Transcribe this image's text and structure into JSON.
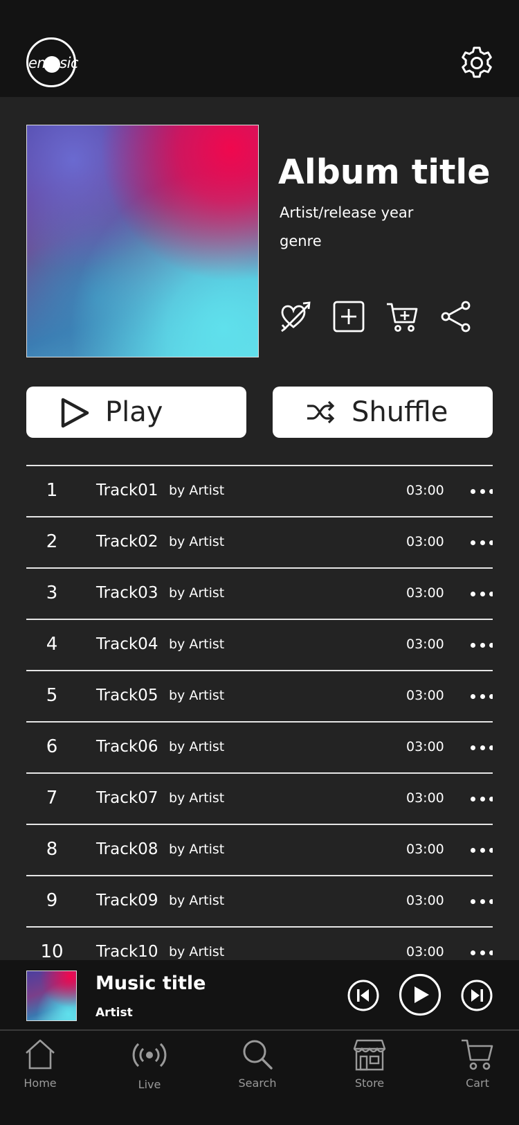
{
  "header": {
    "logo_text": "emusic",
    "icons": {
      "logo": "vinyl-logo",
      "settings": "gear-icon"
    }
  },
  "album": {
    "title": "Album title",
    "artist_year": "Artist/release year",
    "genre": "genre",
    "actions": [
      "heart-arrow-icon",
      "add-square-icon",
      "add-to-cart-icon",
      "share-icon"
    ]
  },
  "buttons": {
    "play": "Play",
    "shuffle": "Shuffle"
  },
  "tracks": [
    {
      "num": "1",
      "title": "Track01",
      "artist": "by Artist",
      "duration": "03:00"
    },
    {
      "num": "2",
      "title": "Track02",
      "artist": "by Artist",
      "duration": "03:00"
    },
    {
      "num": "3",
      "title": "Track03",
      "artist": "by Artist",
      "duration": "03:00"
    },
    {
      "num": "4",
      "title": "Track04",
      "artist": "by Artist",
      "duration": "03:00"
    },
    {
      "num": "5",
      "title": "Track05",
      "artist": "by Artist",
      "duration": "03:00"
    },
    {
      "num": "6",
      "title": "Track06",
      "artist": "by Artist",
      "duration": "03:00"
    },
    {
      "num": "7",
      "title": "Track07",
      "artist": "by Artist",
      "duration": "03:00"
    },
    {
      "num": "8",
      "title": "Track08",
      "artist": "by Artist",
      "duration": "03:00"
    },
    {
      "num": "9",
      "title": "Track09",
      "artist": "by Artist",
      "duration": "03:00"
    },
    {
      "num": "10",
      "title": "Track10",
      "artist": "by Artist",
      "duration": "03:00"
    }
  ],
  "player": {
    "title": "Music title",
    "artist": "Artist",
    "controls": [
      "previous-icon",
      "play-icon",
      "next-icon"
    ]
  },
  "tabs": [
    {
      "label": "Home",
      "icon": "home-icon"
    },
    {
      "label": "Live",
      "icon": "broadcast-icon"
    },
    {
      "label": "Search",
      "icon": "search-icon"
    },
    {
      "label": "Store",
      "icon": "store-icon"
    },
    {
      "label": "Cart",
      "icon": "cart-icon"
    }
  ],
  "colors": {
    "background": "#232323",
    "bars": "#131313",
    "foreground": "#ffffff",
    "tab_label": "#9a9a9a"
  }
}
